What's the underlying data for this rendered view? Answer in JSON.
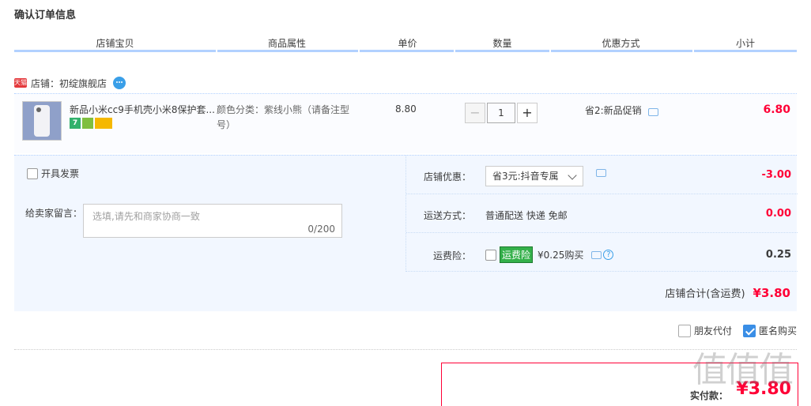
{
  "page": {
    "title": "确认订单信息"
  },
  "columns": [
    "店铺宝贝",
    "商品属性",
    "单价",
    "数量",
    "优惠方式",
    "小计"
  ],
  "shop": {
    "badge": "天猫",
    "label": "店铺：初绽旗舰店"
  },
  "item": {
    "name": "新品小米cc9手机壳小米8保护套...",
    "attribute": "颜色分类：紫线小熊（请备注型号）",
    "unit_price": "8.80",
    "quantity": "1",
    "promo": "省2:新品促销",
    "subtotal": "6.80",
    "badges": [
      "7",
      "",
      ""
    ]
  },
  "details": {
    "invoice_label": "开具发票",
    "message_label": "给卖家留言：",
    "message_placeholder": "选填,请先和商家协商一致",
    "message_count": "0/200",
    "shop_discount": {
      "label": "店铺优惠：",
      "selected": "省3元:抖音专属",
      "amount": "-3.00"
    },
    "shipping": {
      "label": "运送方式：",
      "value": "普通配送 快递 免邮",
      "amount": "0.00"
    },
    "insurance": {
      "label": "运费险：",
      "tag": "运费险",
      "text": "¥0.25购买",
      "amount": "0.25"
    },
    "shop_total": {
      "label": "店铺合计(含运费)",
      "amount": "¥3.80"
    }
  },
  "options": {
    "friend_pay": "朋友代付",
    "anonymous": "匿名购买",
    "anonymous_checked": true
  },
  "payment": {
    "label": "实付款：",
    "amount": "¥3.80"
  },
  "watermark": "值值值"
}
